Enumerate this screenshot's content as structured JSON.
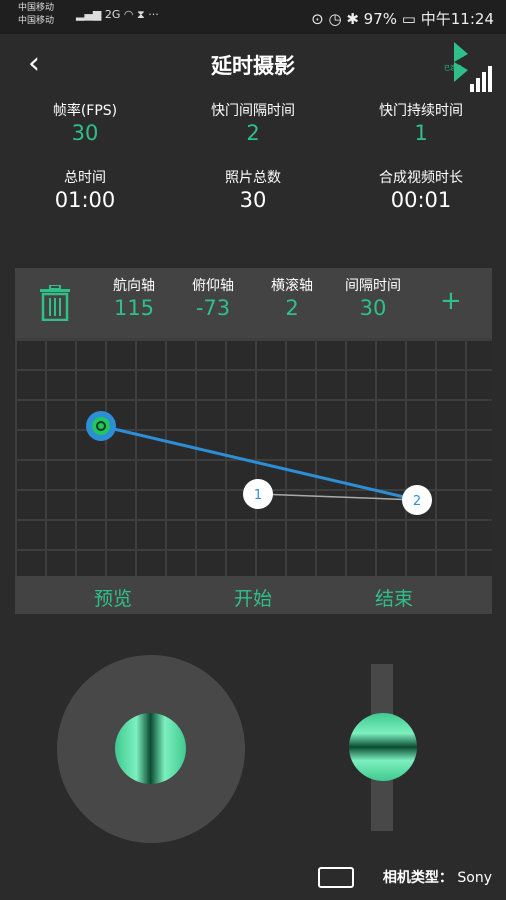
{
  "status_bar": {
    "carrier_line1": "中国移动",
    "carrier_line2": "中国移动",
    "signal_text": "2G",
    "right_text": "⊙ ◷ ✱ 97%",
    "time": "中午11:24"
  },
  "header": {
    "title": "延时摄影",
    "bt_text": "已连接"
  },
  "stats": [
    {
      "label": "帧率(FPS)",
      "value": "30"
    },
    {
      "label": "快门间隔时间",
      "value": "2"
    },
    {
      "label": "快门持续时间",
      "value": "1"
    },
    {
      "label": "总时间",
      "value": "01:00"
    },
    {
      "label": "照片总数",
      "value": "30"
    },
    {
      "label": "合成视频时长",
      "value": "00:01"
    }
  ],
  "axes": [
    {
      "label": "航向轴",
      "value": "115"
    },
    {
      "label": "俯仰轴",
      "value": "-73"
    },
    {
      "label": "横滚轴",
      "value": "2"
    },
    {
      "label": "间隔时间",
      "value": "30"
    }
  ],
  "add_label": "+",
  "points": [
    {
      "label": "1"
    },
    {
      "label": "2"
    }
  ],
  "footer": {
    "preview": "预览",
    "start": "开始",
    "end": "结束"
  },
  "camera": {
    "label": "相机类型：",
    "value": "Sony"
  },
  "colors": {
    "accent": "#2fc08a",
    "line": "#2c8fd6"
  }
}
